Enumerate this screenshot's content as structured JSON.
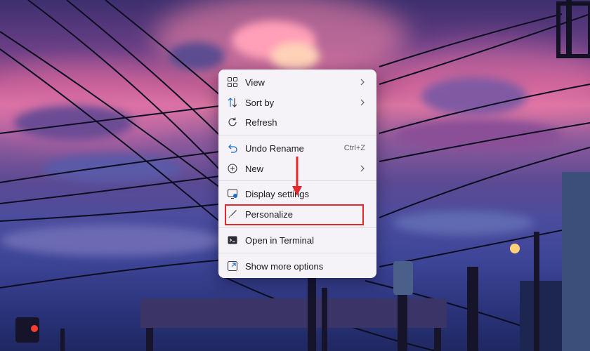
{
  "context_menu": {
    "items": [
      {
        "label": "View",
        "icon": "grid-icon",
        "submenu": true
      },
      {
        "label": "Sort by",
        "icon": "sort-icon",
        "submenu": true
      },
      {
        "label": "Refresh",
        "icon": "refresh-icon"
      },
      {
        "label": "Undo Rename",
        "icon": "undo-icon",
        "shortcut": "Ctrl+Z"
      },
      {
        "label": "New",
        "icon": "plus-circle-icon",
        "submenu": true
      },
      {
        "label": "Display settings",
        "icon": "display-icon"
      },
      {
        "label": "Personalize",
        "icon": "brush-icon"
      },
      {
        "label": "Open in Terminal",
        "icon": "terminal-icon"
      },
      {
        "label": "Show more options",
        "icon": "expand-icon"
      }
    ]
  },
  "annotation": {
    "highlight_target": "Personalize",
    "color": "#e3272a"
  },
  "colors": {
    "menu_background": "#f5f3f7",
    "icon_blue": "#1f6fc6"
  }
}
